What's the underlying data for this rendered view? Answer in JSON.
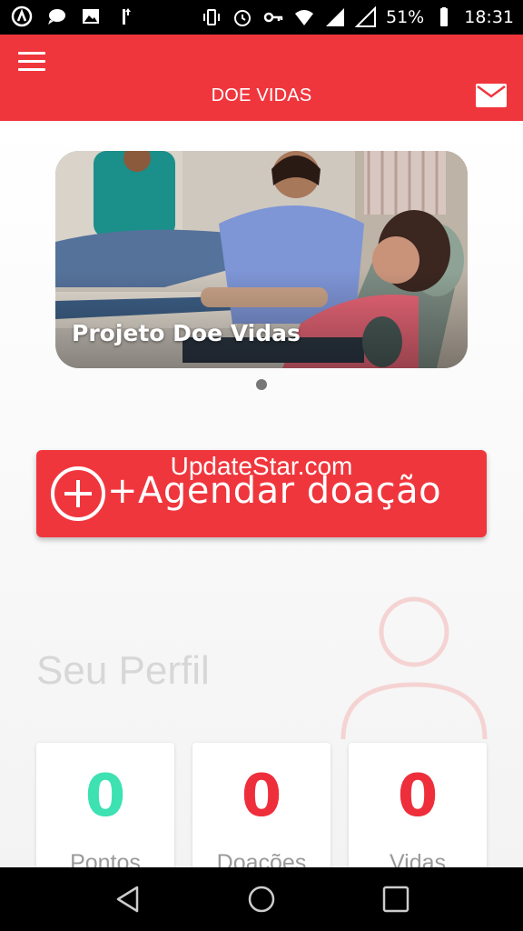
{
  "status_bar": {
    "battery": "51%",
    "time": "18:31",
    "notification_icons": [
      "android-icon",
      "chat-icon",
      "image-icon",
      "upload-icon"
    ],
    "system_icons": [
      "vibrate-icon",
      "alarm-icon",
      "key-icon",
      "wifi-icon",
      "signal-icon",
      "signal-icon",
      "battery-icon"
    ]
  },
  "app_bar": {
    "title": "DOE VIDAS",
    "menu_icon": "hamburger-icon",
    "mail_icon": "mail-icon",
    "background": "#f0363d"
  },
  "banner": {
    "caption": "Projeto Doe Vidas",
    "active_index": 0,
    "count": 1
  },
  "agendar_button": {
    "label": "+Agendar doação",
    "icon": "plus-circle-icon"
  },
  "watermark": "UpdateStar.com",
  "profile": {
    "title": "Seu Perfil",
    "stats": [
      {
        "value": "0",
        "label": "Pontos",
        "color": "#3de1b2"
      },
      {
        "value": "0",
        "label": "Doações",
        "color": "#ee2f3b"
      },
      {
        "value": "0",
        "label": "Vidas",
        "color": "#ee2f3b"
      }
    ]
  },
  "nav_bar": {
    "back": "back-icon",
    "home": "home-icon",
    "recents": "recents-icon"
  }
}
